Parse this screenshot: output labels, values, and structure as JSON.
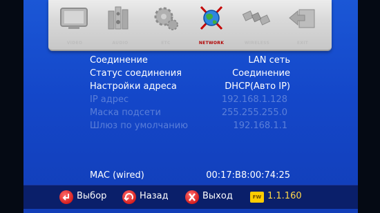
{
  "menu": {
    "items": [
      {
        "label": "VIDEO",
        "icon": "tv-icon"
      },
      {
        "label": "AUDIO",
        "icon": "speakers-icon"
      },
      {
        "label": "ETC",
        "icon": "gears-icon"
      },
      {
        "label": "NETWORK",
        "icon": "globe-icon",
        "selected": true
      },
      {
        "label": "WIRELESS",
        "icon": "satellite-icon"
      },
      {
        "label": "EXIT",
        "icon": "exit-arrow-icon"
      }
    ]
  },
  "network": {
    "connection_label": "Соединение",
    "connection_value": "LAN сеть",
    "status_label": "Статус соединения",
    "status_value": "Соединение",
    "address_label": "Настройки адреса",
    "address_value": "DHCP(Авто IP)",
    "ip_label": "IP адрес",
    "ip_value": "192.168.1.128",
    "mask_label": "Маска подсети",
    "mask_value": "255.255.255.0",
    "gateway_label": "Шлюз по умолчанию",
    "gateway_value": "192.168.1.1",
    "mac_label": "MAC (wired)",
    "mac_value": "00:17:B8:00:74:25"
  },
  "footer": {
    "select_label": "Выбор",
    "back_label": "Назад",
    "exit_label": "Выход",
    "fw_badge": "FW",
    "fw_version": "1.1.160"
  },
  "colors": {
    "background": "#1447c9",
    "text_active": "#ffffff",
    "text_disabled": "#5b7fd9",
    "accent_red": "#c40000",
    "fw_yellow": "#ffcc00"
  }
}
